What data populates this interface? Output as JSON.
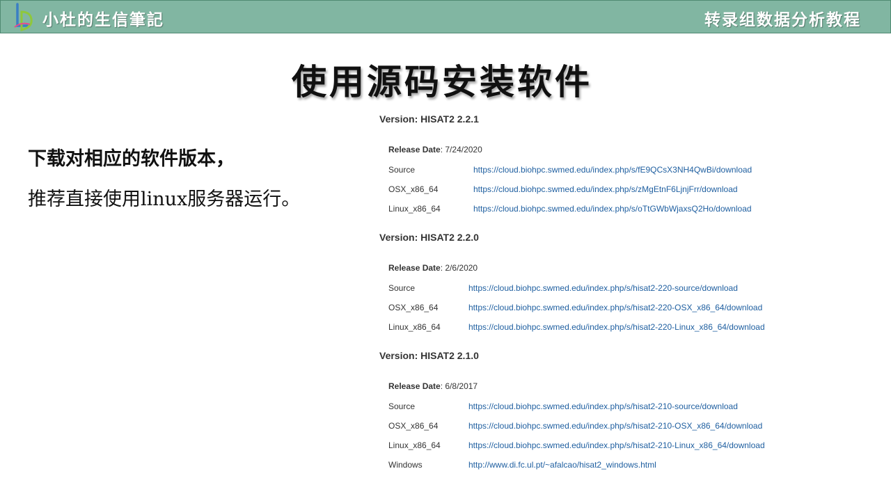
{
  "header": {
    "brand": "小杜的生信筆記",
    "course": "转录组数据分析教程",
    "logo_icon": "ld-logo-icon",
    "bar_color": "#81b6a2"
  },
  "title": "使用源码安装软件",
  "left_text": {
    "line1": "下载对相应的软件版本，",
    "line2": "推荐直接使用linux服务器运行。"
  },
  "link_color": "#1f5fa0",
  "versions": [
    {
      "heading": "Version: HISAT2 2.2.1",
      "release_label": "Release Date",
      "release_date": ": 7/24/2020",
      "downloads": [
        {
          "platform": "Source",
          "url": "https://cloud.biohpc.swmed.edu/index.php/s/fE9QCsX3NH4QwBi/download"
        },
        {
          "platform": "OSX_x86_64",
          "url": "https://cloud.biohpc.swmed.edu/index.php/s/zMgEtnF6LjnjFrr/download"
        },
        {
          "platform": "Linux_x86_64",
          "url": "https://cloud.biohpc.swmed.edu/index.php/s/oTtGWbWjaxsQ2Ho/download"
        }
      ]
    },
    {
      "heading": "Version: HISAT2 2.2.0",
      "release_label": "Release Date",
      "release_date": ": 2/6/2020",
      "downloads": [
        {
          "platform": "Source",
          "url": "https://cloud.biohpc.swmed.edu/index.php/s/hisat2-220-source/download"
        },
        {
          "platform": "OSX_x86_64",
          "url": "https://cloud.biohpc.swmed.edu/index.php/s/hisat2-220-OSX_x86_64/download"
        },
        {
          "platform": "Linux_x86_64",
          "url": "https://cloud.biohpc.swmed.edu/index.php/s/hisat2-220-Linux_x86_64/download"
        }
      ]
    },
    {
      "heading": "Version: HISAT2 2.1.0",
      "release_label": "Release Date",
      "release_date": ": 6/8/2017",
      "downloads": [
        {
          "platform": "Source",
          "url": "https://cloud.biohpc.swmed.edu/index.php/s/hisat2-210-source/download"
        },
        {
          "platform": "OSX_x86_64",
          "url": "https://cloud.biohpc.swmed.edu/index.php/s/hisat2-210-OSX_x86_64/download"
        },
        {
          "platform": "Linux_x86_64",
          "url": "https://cloud.biohpc.swmed.edu/index.php/s/hisat2-210-Linux_x86_64/download"
        },
        {
          "platform": "Windows",
          "url": "http://www.di.fc.ul.pt/~afalcao/hisat2_windows.html"
        }
      ]
    }
  ]
}
